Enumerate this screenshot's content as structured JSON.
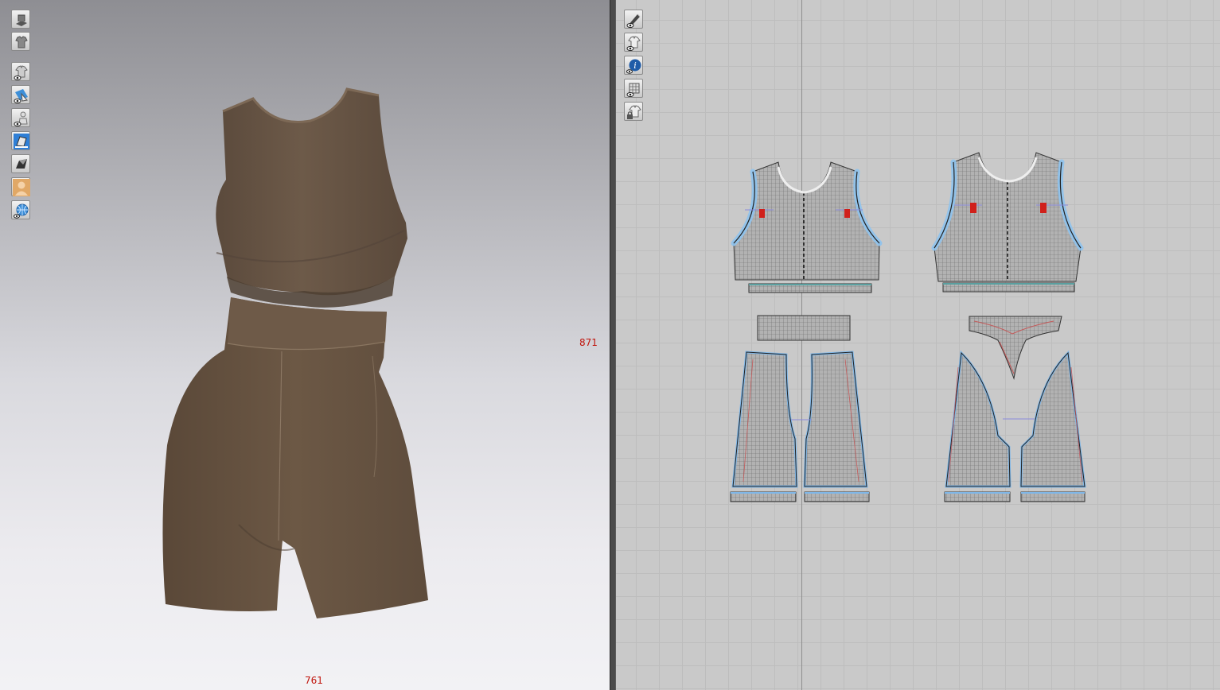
{
  "viewport_3d": {
    "toolbar": [
      "solid-view-icon",
      "garment-avatar-icon",
      "show-garment-icon",
      "show-texture-icon",
      "show-avatar-icon",
      "render-mode-icon",
      "cloth-shading-icon",
      "avatar-skin-icon",
      "environment-globe-icon"
    ],
    "measure_height": "871",
    "measure_width": "761",
    "garment_color": "#6b5746"
  },
  "viewport_2d": {
    "toolbar": [
      "pattern-edit-pen-icon",
      "show-garment-2d-icon",
      "pattern-info-icon",
      "grid-pattern-icon",
      "lock-pattern-icon"
    ],
    "pattern_fill": "#a9a9a9",
    "seam_color": "#78b6e8",
    "notch_color": "#d0201a"
  }
}
